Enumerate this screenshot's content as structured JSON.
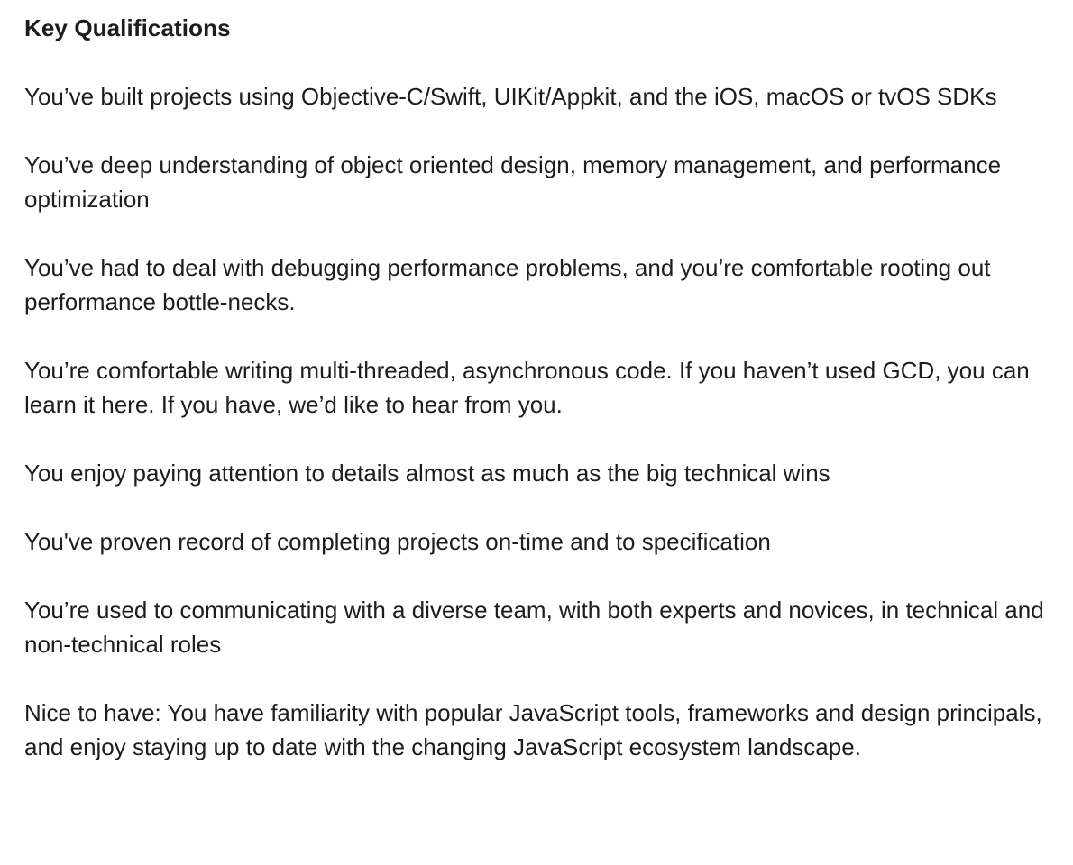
{
  "section": {
    "heading": "Key Qualifications",
    "paragraphs": [
      "You’ve built projects using Objective-C/Swift, UIKit/Appkit, and the iOS, macOS or tvOS SDKs",
      "You’ve deep understanding of object oriented design, memory management, and performance optimization",
      "You’ve had to deal with debugging performance problems, and you’re comfortable rooting out performance bottle-necks.",
      "You’re comfortable writing multi-threaded, asynchronous code. If you haven’t used GCD, you can learn it here. If you have, we’d like to hear from you.",
      "You enjoy paying attention to details almost as much as the big technical wins",
      "You've proven record of completing projects on-time and to specification",
      "You’re used to communicating with a diverse team, with both experts and novices, in technical and non-technical roles",
      "Nice to have: You have familiarity with popular JavaScript tools, frameworks and design principals, and enjoy staying up to date with the changing JavaScript ecosystem landscape."
    ]
  }
}
